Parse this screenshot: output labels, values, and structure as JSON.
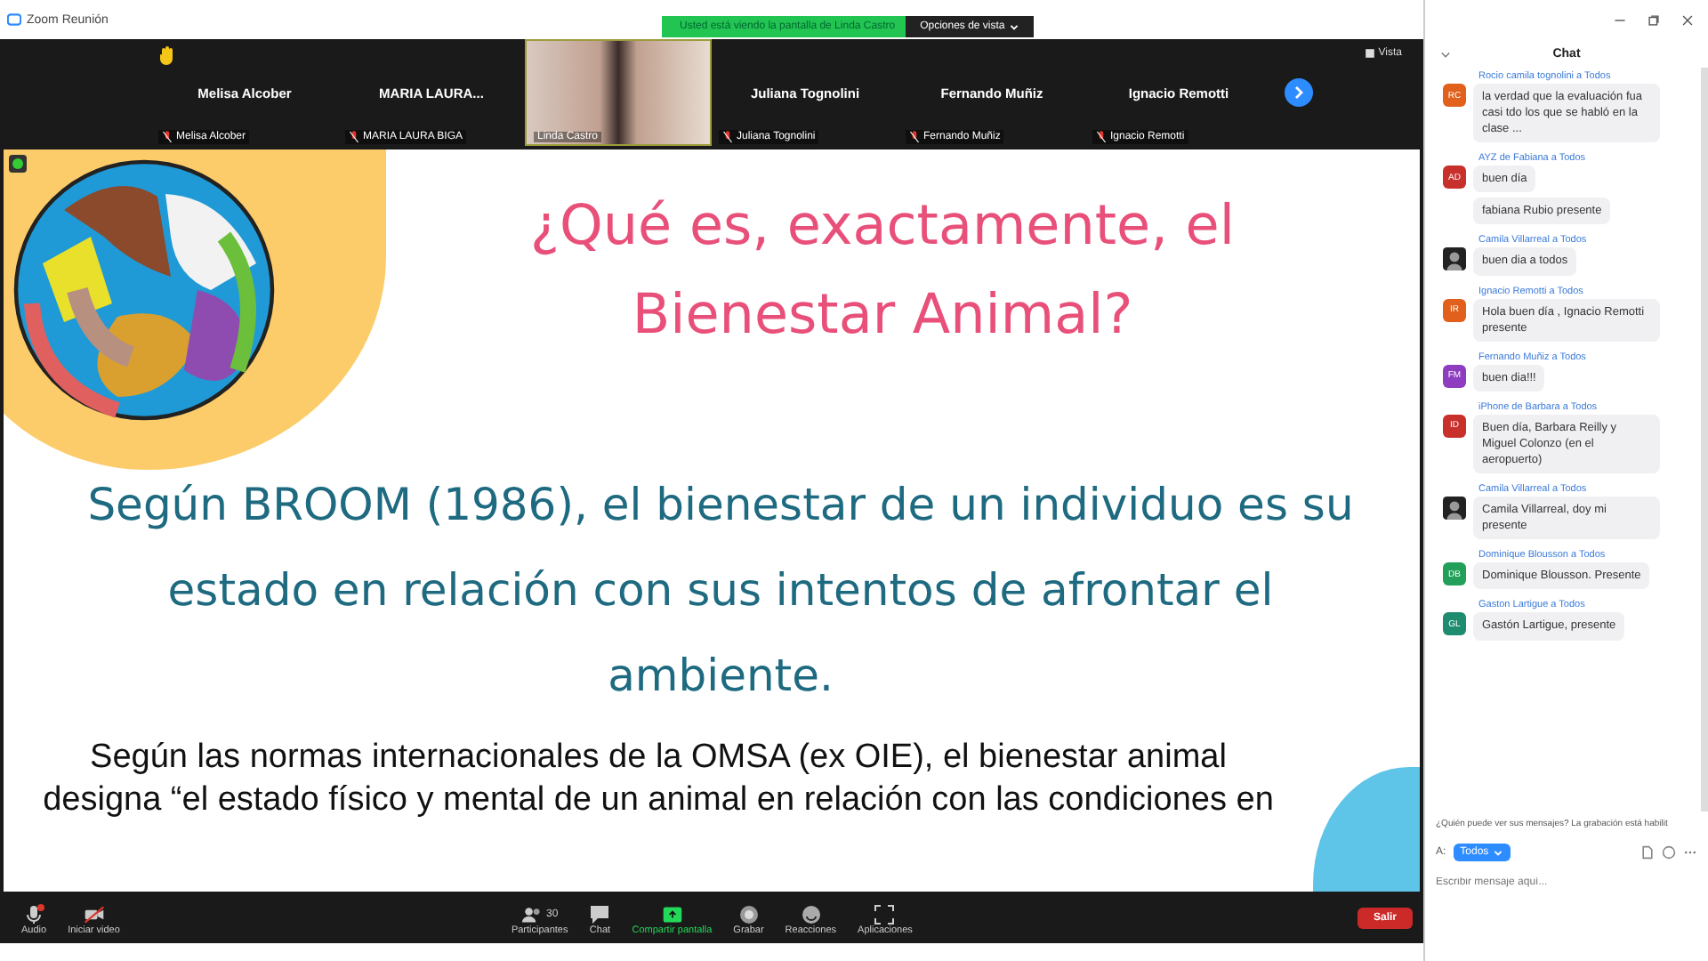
{
  "window": {
    "title": "Zoom Reunión"
  },
  "share_banner": {
    "text": "Usted está viendo la pantalla de Linda Castro",
    "options": "Opciones de vista"
  },
  "participants": [
    {
      "name": "Melisa Alcober",
      "label": "Melisa Alcober",
      "muted": true,
      "video": false,
      "hand_raised": true
    },
    {
      "name": "MARIA LAURA...",
      "label": "MARIA LAURA BIGA",
      "muted": true,
      "video": false,
      "hand_raised": false
    },
    {
      "label": "Linda Castro",
      "muted": false,
      "video": true,
      "hand_raised": false
    },
    {
      "name": "Juliana Tognolini",
      "label": "Juliana Tognolini",
      "muted": true,
      "video": false,
      "hand_raised": false
    },
    {
      "name": "Fernando Muñiz",
      "label": "Fernando Muñiz",
      "muted": true,
      "video": false,
      "hand_raised": false
    },
    {
      "name": "Ignacio Remotti",
      "label": "Ignacio Remotti",
      "muted": true,
      "video": false,
      "hand_raised": false
    }
  ],
  "view_button": "Vista",
  "slide": {
    "title": "¿Qué es, exactamente, el Bienestar Animal?",
    "body": "Según BROOM (1986), el bienestar de un individuo es su estado en relación con sus intentos de afrontar el ambiente.",
    "paragraph": "Según las normas internacionales de la OMSA (ex OIE), el bienestar animal designa “el estado físico y mental de un animal en relación con las condiciones en"
  },
  "toolbar": [
    {
      "kind": "audio",
      "label": "Audio",
      "badge": true
    },
    {
      "kind": "video",
      "label": "Iniciar video"
    },
    {
      "kind": "participants",
      "label": "Participantes",
      "count": "30"
    },
    {
      "kind": "chat",
      "label": "Chat"
    },
    {
      "kind": "share",
      "label": "Compartir pantalla"
    },
    {
      "kind": "record",
      "label": "Grabar"
    },
    {
      "kind": "reactions",
      "label": "Reacciones"
    },
    {
      "kind": "apps",
      "label": "Aplicaciones"
    }
  ],
  "leave_button": "Salir",
  "chat": {
    "title": "Chat",
    "messages": [
      {
        "sender": "Rocio camila tognolini",
        "to_word": "a",
        "to": "Todos",
        "avatar": {
          "kind": "initials",
          "initials": "RC",
          "color": "#e0601c"
        },
        "texts": [
          "la verdad que la evaluación fua casi tdo los que se habló en la clase ..."
        ]
      },
      {
        "sender": "AYZ de Fabiana",
        "to_word": "a",
        "to": "Todos",
        "avatar": {
          "kind": "initials",
          "initials": "AD",
          "color": "#c8302c"
        },
        "texts": [
          "buen día",
          "fabiana Rubio presente"
        ]
      },
      {
        "sender": "Camila Villarreal",
        "to_word": "a",
        "to": "Todos",
        "avatar": {
          "kind": "photo"
        },
        "texts": [
          "buen dia a todos"
        ]
      },
      {
        "sender": "Ignacio Remotti",
        "to_word": "a",
        "to": "Todos",
        "avatar": {
          "kind": "initials",
          "initials": "IR",
          "color": "#e0601c"
        },
        "texts": [
          "Hola buen día , Ignacio Remotti presente"
        ]
      },
      {
        "sender": "Fernando Muñiz",
        "to_word": "a",
        "to": "Todos",
        "avatar": {
          "kind": "initials",
          "initials": "FM",
          "color": "#8e3cc0"
        },
        "texts": [
          "buen dia!!!"
        ]
      },
      {
        "sender": "iPhone de Barbara",
        "to_word": "a",
        "to": "Todos",
        "avatar": {
          "kind": "initials",
          "initials": "ID",
          "color": "#c8302c"
        },
        "texts": [
          "Buen día, Barbara Reilly y Miguel Colonzo (en el aeropuerto)"
        ]
      },
      {
        "sender": "Camila Villarreal",
        "to_word": "a",
        "to": "Todos",
        "avatar": {
          "kind": "photo"
        },
        "texts": [
          "Camila Villarreal, doy mi presente"
        ]
      },
      {
        "sender": "Dominique Blousson",
        "to_word": "a",
        "to": "Todos",
        "avatar": {
          "kind": "initials",
          "initials": "DB",
          "color": "#22a05a"
        },
        "texts": [
          "Dominique Blousson. Presente"
        ]
      },
      {
        "sender": "Gaston Lartigue",
        "to_word": "a",
        "to": "Todos",
        "avatar": {
          "kind": "initials",
          "initials": "GL",
          "color": "#1e8c6e"
        },
        "texts": [
          "Gastón Lartigue, presente"
        ]
      }
    ],
    "notice": "¿Quién puede ver sus mensajes? La grabación está habilit",
    "to_label": "A:",
    "recipient": "Todos",
    "placeholder": "Escribir mensaje aquí..."
  }
}
